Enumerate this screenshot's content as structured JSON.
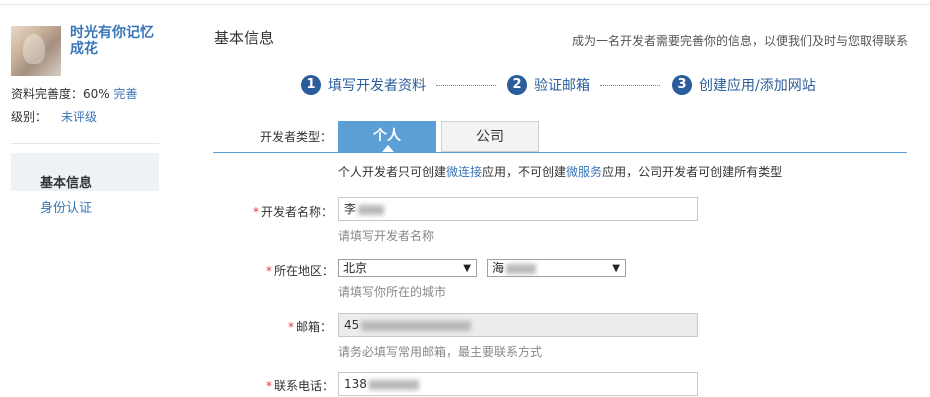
{
  "sidebar": {
    "username": "时光有你记忆成花",
    "completeness_label": "资料完善度：60%",
    "completeness_link": "完善",
    "level_label": "级别：",
    "level_value": "未评级",
    "nav": [
      {
        "label": "基本信息",
        "active": true
      },
      {
        "label": "身份认证",
        "active": false
      }
    ]
  },
  "header": {
    "title": "基本信息",
    "description": "成为一名开发者需要完善你的信息，以便我们及时与您取得联系"
  },
  "steps": [
    {
      "num": "1",
      "label": "填写开发者资料"
    },
    {
      "num": "2",
      "label": "验证邮箱"
    },
    {
      "num": "3",
      "label": "创建应用/添加网站"
    }
  ],
  "developer_type": {
    "label": "开发者类型：",
    "tabs": [
      "个人",
      "公司"
    ],
    "selected": "个人",
    "note_before": "个人开发者只可创建",
    "note_link1": "微连接",
    "note_mid": "应用，不可创建",
    "note_link2": "微服务",
    "note_after": "应用，公司开发者可创建所有类型"
  },
  "form": {
    "name": {
      "label": "开发者名称：",
      "value": "李",
      "hint": "请填写开发者名称"
    },
    "region": {
      "label": "所在地区：",
      "province": "北京",
      "city": "海",
      "hint": "请填写你所在的城市"
    },
    "email": {
      "label": "邮箱：",
      "value": "45",
      "hint": "请务必填写常用邮箱，最主要联系方式"
    },
    "phone": {
      "label": "联系电话：",
      "value": "138"
    }
  },
  "colors": {
    "accent": "#2b5d9c",
    "link": "#3a75b8",
    "tab_active": "#5b9fd6",
    "required": "#e0393e"
  }
}
